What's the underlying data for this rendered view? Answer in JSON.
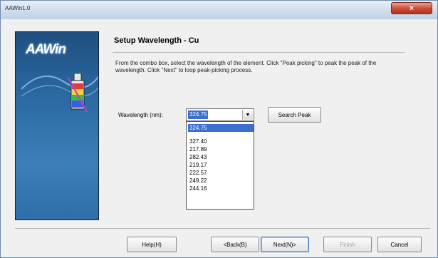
{
  "window": {
    "title": "AAWin1.0",
    "close_glyph": "×"
  },
  "side_panel": {
    "logo": "AAWin",
    "icon": "flask-icon"
  },
  "page": {
    "heading": "Setup Wavelength - Cu",
    "instructions": "From the combo box, select the wavelength of the element. Click \"Peak picking\" to peak the peak of the wavelength. Click \"Next\" to loop peak-picking process."
  },
  "wavelength": {
    "label": "Wavelength (nm):",
    "selected": "324.75",
    "options": [
      "324.75",
      "327.40",
      "217.89",
      "282.43",
      "219.17",
      "222.57",
      "249.22",
      "244.16"
    ]
  },
  "buttons": {
    "search_peak": "Search Peak",
    "help": "Help(H)",
    "back": "<Back(B)",
    "next": "Next(N)>",
    "finish": "Finish",
    "cancel": "Cancel"
  },
  "colors": {
    "selection": "#3b6fd0",
    "side_panel": "#2b6aa3"
  }
}
